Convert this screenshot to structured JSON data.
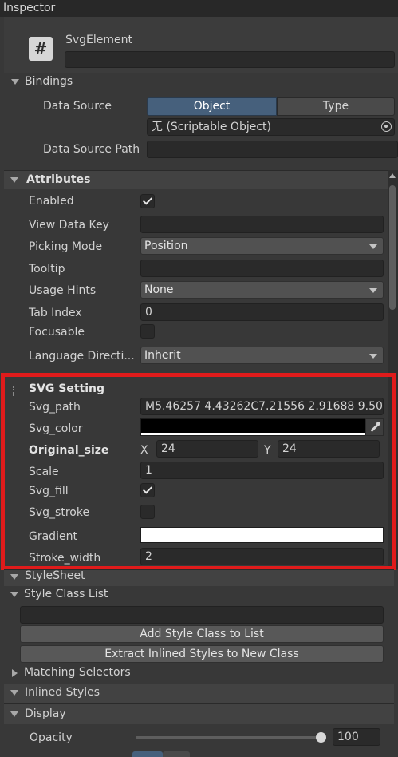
{
  "window": {
    "title": "Inspector"
  },
  "element": {
    "type_icon": "#",
    "name": "SvgElement",
    "name_value": ""
  },
  "bindings": {
    "header": "Bindings",
    "data_source_label": "Data Source",
    "tabs": [
      "Object",
      "Type"
    ],
    "active_tab": "Object",
    "object_value": "无 (Scriptable Object)",
    "data_source_path_label": "Data Source Path",
    "data_source_path_value": ""
  },
  "attributes": {
    "header": "Attributes",
    "enabled_label": "Enabled",
    "enabled": true,
    "view_data_key_label": "View Data Key",
    "view_data_key_value": "",
    "picking_mode_label": "Picking Mode",
    "picking_mode_value": "Position",
    "tooltip_label": "Tooltip",
    "tooltip_value": "",
    "usage_hints_label": "Usage Hints",
    "usage_hints_value": "None",
    "tab_index_label": "Tab Index",
    "tab_index_value": "0",
    "focusable_label": "Focusable",
    "focusable": false,
    "language_direction_label": "Language Directi...",
    "language_direction_value": "Inherit"
  },
  "svg_setting": {
    "header": "SVG Setting",
    "svg_path_label": "Svg_path",
    "svg_path_value": "M5.46257 4.43262C7.21556 2.91688 9.50",
    "svg_color_label": "Svg_color",
    "svg_color_value": "#000000",
    "original_size_label": "Original_size",
    "x_label": "X",
    "x_value": "24",
    "y_label": "Y",
    "y_value": "24",
    "scale_label": "Scale",
    "scale_value": "1",
    "svg_fill_label": "Svg_fill",
    "svg_fill": true,
    "svg_stroke_label": "Svg_stroke",
    "svg_stroke": false,
    "gradient_label": "Gradient",
    "gradient_value": "#ffffff",
    "stroke_width_label": "Stroke_width",
    "stroke_width_value": "2",
    "highlight_color": "#e01b1b"
  },
  "stylesheet": {
    "header": "StyleSheet",
    "style_class_list_label": "Style Class List",
    "style_class_input_value": "",
    "add_style_class_button": "Add Style Class to List",
    "extract_inlined_button": "Extract Inlined Styles to New Class",
    "matching_selectors_label": "Matching Selectors"
  },
  "inlined_styles": {
    "header": "Inlined Styles",
    "display_label": "Display",
    "opacity_label": "Opacity",
    "opacity_value": "100",
    "opacity_fraction": 1.0
  },
  "colors": {
    "accent_tab": "#46607c",
    "background": "#383838",
    "header_bg": "#424242"
  }
}
